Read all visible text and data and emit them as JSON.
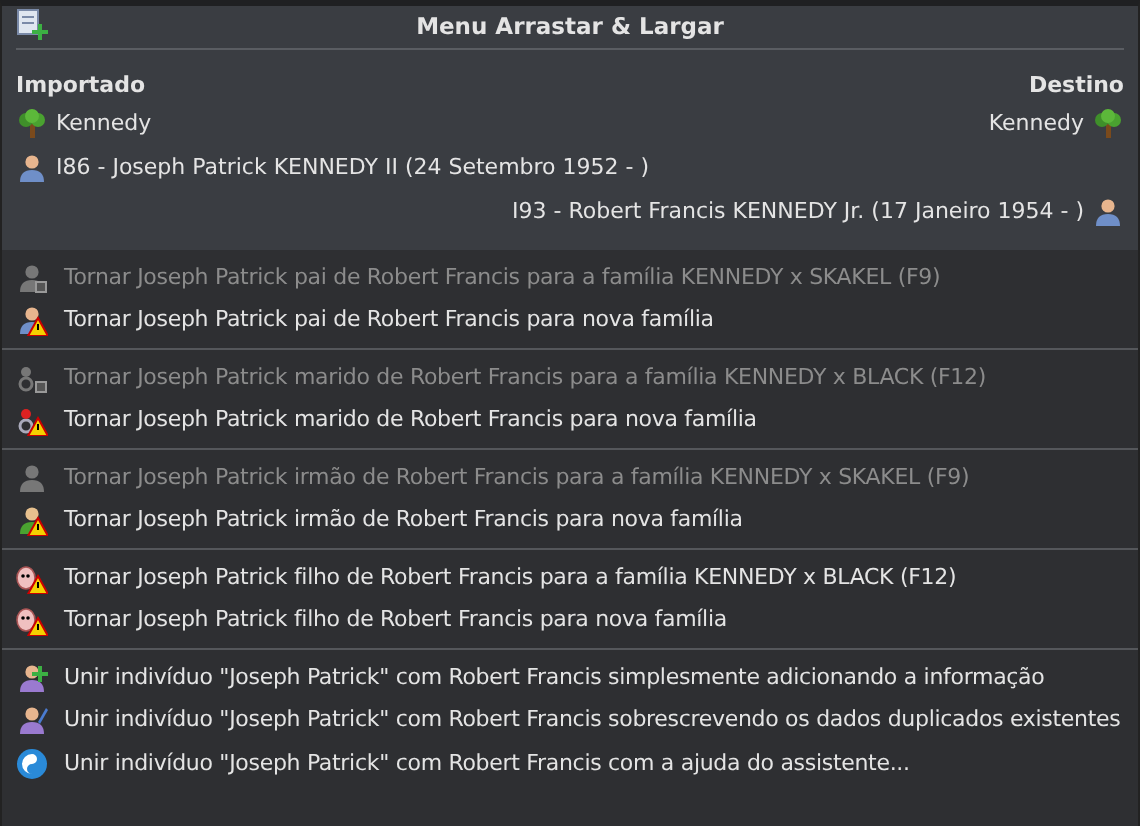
{
  "title": "Menu Arrastar & Largar",
  "imported": {
    "heading": "Importado",
    "tree": "Kennedy",
    "person": "I86 - Joseph Patrick KENNEDY II (24 Setembro 1952 - )"
  },
  "destination": {
    "heading": "Destino",
    "tree": "Kennedy",
    "person": "I93 - Robert Francis KENNEDY Jr. (17 Janeiro 1954 - )"
  },
  "groups": [
    {
      "items": [
        {
          "kind": "father",
          "label": "Tornar Joseph Patrick pai de Robert Francis para a família KENNEDY x SKAKEL (F9)",
          "disabled": true
        },
        {
          "kind": "father",
          "label": "Tornar Joseph Patrick pai de Robert Francis para nova família",
          "disabled": false
        }
      ]
    },
    {
      "items": [
        {
          "kind": "husband",
          "label": "Tornar Joseph Patrick marido de Robert Francis para a família KENNEDY x BLACK (F12)",
          "disabled": true
        },
        {
          "kind": "husband",
          "label": "Tornar Joseph Patrick marido de Robert Francis para nova família",
          "disabled": false
        }
      ]
    },
    {
      "items": [
        {
          "kind": "brother",
          "label": "Tornar Joseph Patrick irmão de Robert Francis para a família KENNEDY x SKAKEL (F9)",
          "disabled": true
        },
        {
          "kind": "brother",
          "label": "Tornar Joseph Patrick irmão de Robert Francis para nova família",
          "disabled": false
        }
      ]
    },
    {
      "items": [
        {
          "kind": "son",
          "label": "Tornar Joseph Patrick filho de Robert Francis para a família KENNEDY x BLACK (F12)",
          "disabled": false
        },
        {
          "kind": "son",
          "label": "Tornar Joseph Patrick filho de Robert Francis para nova família",
          "disabled": false
        }
      ]
    },
    {
      "items": [
        {
          "kind": "merge-add",
          "label": "Unir indivíduo \"Joseph Patrick\" com Robert Francis simplesmente adicionando a informação",
          "disabled": false
        },
        {
          "kind": "merge-edit",
          "label": "Unir indivíduo \"Joseph Patrick\" com Robert Francis sobrescrevendo os dados duplicados existentes",
          "disabled": false
        },
        {
          "kind": "wizard",
          "label": "Unir indivíduo \"Joseph Patrick\" com Robert Francis com a ajuda do assistente...",
          "disabled": false
        }
      ]
    }
  ]
}
